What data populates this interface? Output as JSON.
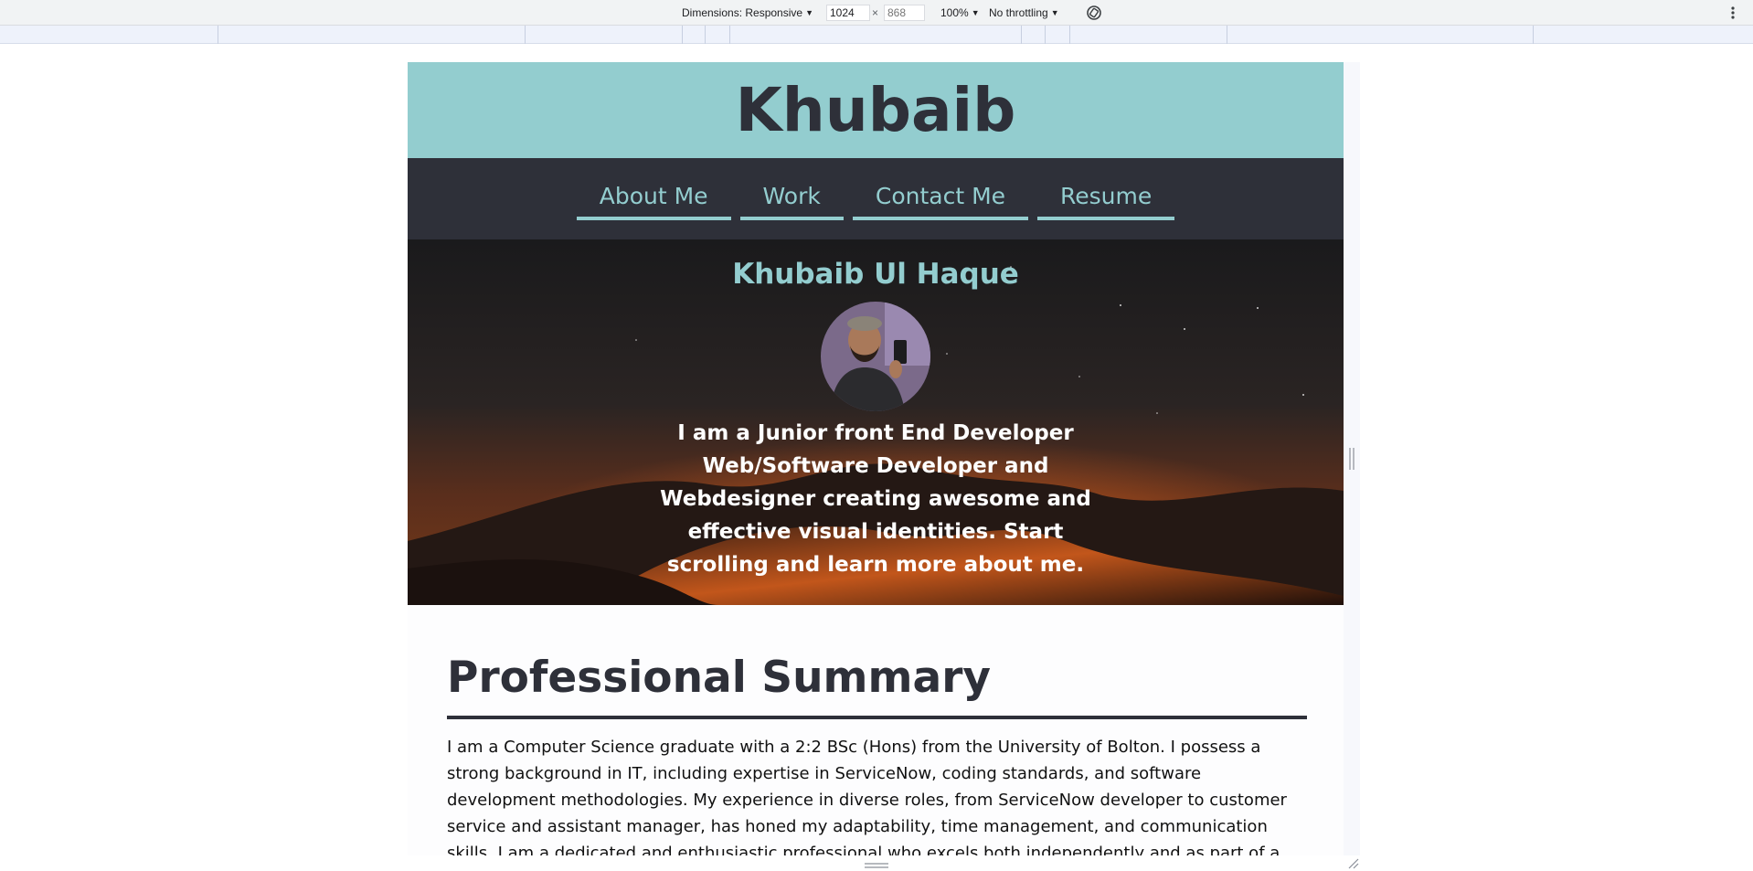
{
  "devtools": {
    "dimensions_label": "Dimensions: Responsive",
    "width_value": "1024",
    "times_sign": "×",
    "height_placeholder": "868",
    "zoom": "100%",
    "throttling": "No throttling"
  },
  "site": {
    "header_title": "Khubaib",
    "nav": [
      {
        "label": "About Me"
      },
      {
        "label": "Work"
      },
      {
        "label": "Contact Me"
      },
      {
        "label": "Resume"
      }
    ],
    "hero": {
      "name": "Khubaib Ul Haque",
      "intro": "I am a Junior front End Developer Web/Software Developer and Webdesigner creating awesome and effective visual identities. Start scrolling and learn more about me."
    },
    "summary": {
      "heading": "Professional Summary",
      "text": "I am a Computer Science graduate with a 2:2 BSc (Hons) from the University of Bolton. I possess a strong background in IT, including expertise in ServiceNow, coding standards, and software development methodologies. My experience in diverse roles, from ServiceNow developer to customer service and assistant manager, has honed my adaptability, time management, and communication skills. I am a dedicated and enthusiastic professional who excels both independently and as part of a team. I am now"
    }
  },
  "colors": {
    "accent": "#93cdcf",
    "dark": "#2e3039"
  }
}
